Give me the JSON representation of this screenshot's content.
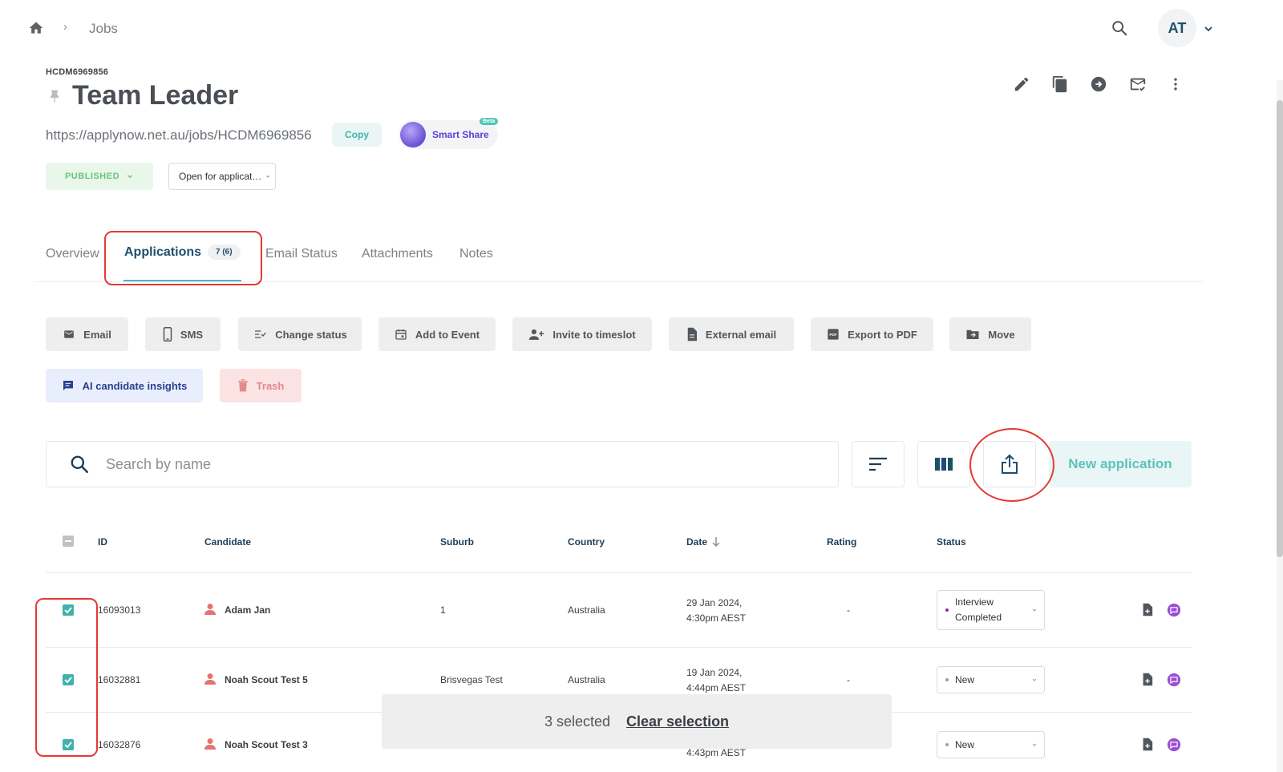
{
  "breadcrumb": {
    "home_icon": "home-icon",
    "separator": "›",
    "current": "Jobs"
  },
  "header": {
    "avatar_initials": "AT"
  },
  "job": {
    "code": "HCDM6969856",
    "title": "Team Leader",
    "url": "https://applynow.net.au/jobs/HCDM6969856",
    "copy_label": "Copy",
    "smart_share_label": "Smart Share",
    "beta_label": "Beta",
    "publish_status": "PUBLISHED",
    "open_status": "Open for applicat…"
  },
  "tabs": [
    {
      "label": "Overview"
    },
    {
      "label": "Applications",
      "badge": "7 (6)"
    },
    {
      "label": "Email Status"
    },
    {
      "label": "Attachments"
    },
    {
      "label": "Notes"
    }
  ],
  "actions": {
    "email": "Email",
    "sms": "SMS",
    "change_status": "Change status",
    "add_to_event": "Add to Event",
    "invite_timeslot": "Invite to timeslot",
    "external_email": "External email",
    "export_pdf": "Export to PDF",
    "move": "Move",
    "ai_insights": "AI candidate insights",
    "trash": "Trash"
  },
  "search": {
    "placeholder": "Search by name"
  },
  "new_application_label": "New application",
  "table": {
    "headers": {
      "id": "ID",
      "candidate": "Candidate",
      "suburb": "Suburb",
      "country": "Country",
      "date": "Date",
      "rating": "Rating",
      "status": "Status"
    },
    "rows": [
      {
        "id": "16093013",
        "candidate": "Adam Jan",
        "suburb": "1",
        "country": "Australia",
        "date1": "29 Jan 2024,",
        "date2": "4:30pm AEST",
        "rating": "-",
        "status1": "Interview",
        "status2": "Completed",
        "status_color": "#8e2aa8"
      },
      {
        "id": "16032881",
        "candidate": "Noah Scout Test 5",
        "suburb": "Brisvegas Test",
        "country": "Australia",
        "date1": "19 Jan 2024,",
        "date2": "4:44pm AEST",
        "rating": "-",
        "status1": "New",
        "status2": "",
        "status_color": "#9aa0a6"
      },
      {
        "id": "16032876",
        "candidate": "Noah Scout Test 3",
        "suburb": "",
        "country": "",
        "date1": "",
        "date2": "4:43pm AEST",
        "rating": "",
        "status1": "New",
        "status2": "",
        "status_color": "#9aa0a6"
      }
    ]
  },
  "selection": {
    "count_label": "3 selected",
    "clear_label": "Clear selection"
  },
  "colors": {
    "accent": "#3fb3ab",
    "primary_dark": "#1f4e6b",
    "highlight": "#e53935"
  }
}
